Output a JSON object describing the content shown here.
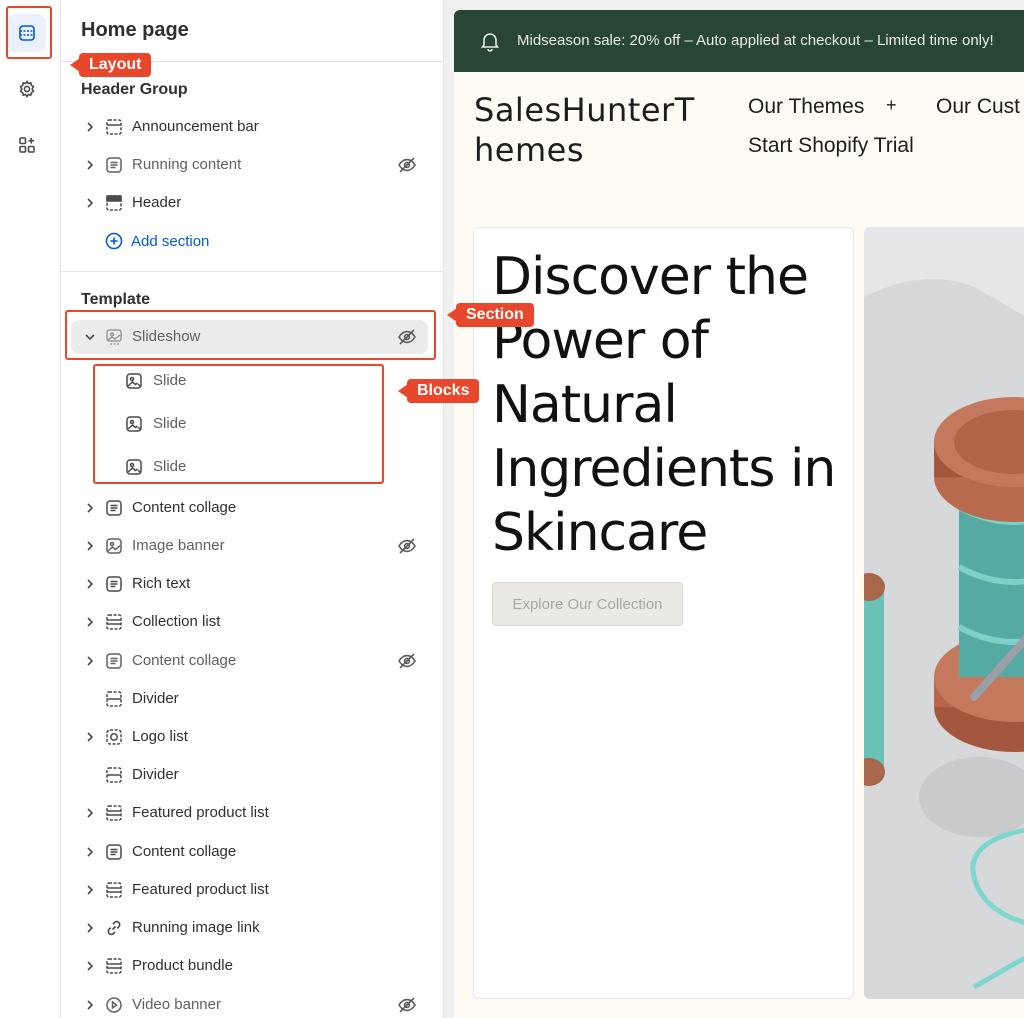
{
  "panel": {
    "title": "Home page",
    "header_group_title": "Header Group",
    "template_title": "Template",
    "add_section_label": "Add section",
    "header_items": [
      {
        "label": "Announcement bar",
        "hidden": false
      },
      {
        "label": "Running content",
        "hidden": true
      },
      {
        "label": "Header",
        "hidden": false
      }
    ],
    "selected_section": {
      "label": "Slideshow",
      "hidden": true
    },
    "blocks": [
      "Slide",
      "Slide",
      "Slide"
    ],
    "sections": [
      {
        "label": "Content collage",
        "hidden": false
      },
      {
        "label": "Image banner",
        "hidden": true
      },
      {
        "label": "Rich text",
        "hidden": false
      },
      {
        "label": "Collection list",
        "hidden": false
      },
      {
        "label": "Content collage",
        "hidden": true
      },
      {
        "label": "Divider",
        "hidden": false
      },
      {
        "label": "Logo list",
        "hidden": false
      },
      {
        "label": "Divider",
        "hidden": false
      },
      {
        "label": "Featured product list",
        "hidden": false
      },
      {
        "label": "Content collage",
        "hidden": false
      },
      {
        "label": "Featured product list",
        "hidden": false
      },
      {
        "label": "Running image link",
        "hidden": false
      },
      {
        "label": "Product bundle",
        "hidden": false
      },
      {
        "label": "Video banner",
        "hidden": true
      }
    ]
  },
  "annotations": {
    "layout": "Layout",
    "section": "Section",
    "blocks": "Blocks",
    "color": "#e8472c"
  },
  "preview": {
    "announcement": "Midseason sale: 20% off – Auto applied at checkout – Limited time only!",
    "logo_line1": "SalesHunterT",
    "logo_line2": "hemes",
    "nav_themes": "Our Themes",
    "nav_plus": "+",
    "nav_cust": "Our Cust",
    "nav_trial": "Start Shopify Trial",
    "hero_title": "Discover the Power of Natural Ingredients in Skincare",
    "hero_button": "Explore Our Collection",
    "announcement_bg": "#294634"
  },
  "icons": {
    "rail": [
      "layout-icon",
      "gear-icon",
      "apps-icon"
    ],
    "eye": "eye-off-icon"
  }
}
